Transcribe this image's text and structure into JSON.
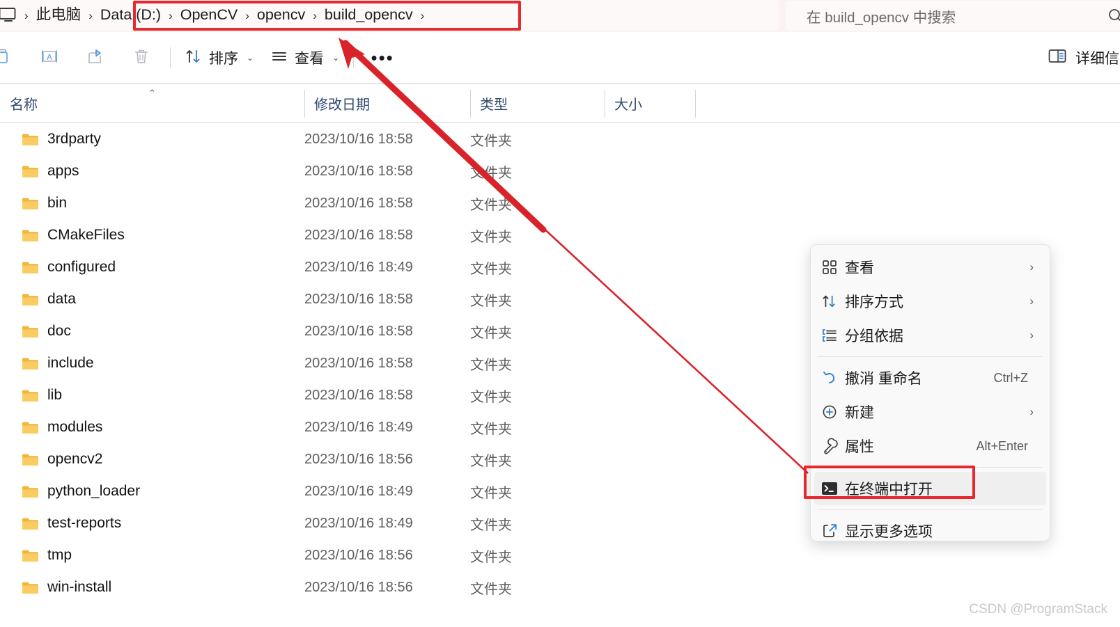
{
  "address_bar": {
    "pc_icon": "this-pc-icon",
    "breadcrumbs": [
      {
        "label": "此电脑",
        "highlighted": false
      },
      {
        "label": "Data (D:)",
        "highlighted": true
      },
      {
        "label": "OpenCV",
        "highlighted": true
      },
      {
        "label": "opencv",
        "highlighted": true
      },
      {
        "label": "build_opencv",
        "highlighted": true
      }
    ],
    "separator": "›",
    "highlight_color": "#e8282d"
  },
  "search": {
    "placeholder": "在 build_opencv 中搜索",
    "icon": "search-icon"
  },
  "toolbar": {
    "icon_buttons": [
      {
        "name": "paste-button",
        "icon": "clipboard-paste-icon"
      },
      {
        "name": "rename-button",
        "icon": "rename-icon"
      },
      {
        "name": "share-button",
        "icon": "share-icon"
      },
      {
        "name": "delete-button",
        "icon": "trash-icon"
      }
    ],
    "sort_label": "排序",
    "view_label": "查看",
    "more_label": "•••",
    "details_label": "详细信息",
    "chevron": "⌄"
  },
  "columns": [
    {
      "label": "名称",
      "sorted": true,
      "sort_caret": "⌃"
    },
    {
      "label": "修改日期",
      "sorted": false
    },
    {
      "label": "类型",
      "sorted": false
    },
    {
      "label": "大小",
      "sorted": false
    }
  ],
  "files": [
    {
      "name": "3rdparty",
      "date": "2023/10/16 18:58",
      "type": "文件夹",
      "size": ""
    },
    {
      "name": "apps",
      "date": "2023/10/16 18:58",
      "type": "文件夹",
      "size": ""
    },
    {
      "name": "bin",
      "date": "2023/10/16 18:58",
      "type": "文件夹",
      "size": ""
    },
    {
      "name": "CMakeFiles",
      "date": "2023/10/16 18:58",
      "type": "文件夹",
      "size": ""
    },
    {
      "name": "configured",
      "date": "2023/10/16 18:49",
      "type": "文件夹",
      "size": ""
    },
    {
      "name": "data",
      "date": "2023/10/16 18:58",
      "type": "文件夹",
      "size": ""
    },
    {
      "name": "doc",
      "date": "2023/10/16 18:58",
      "type": "文件夹",
      "size": ""
    },
    {
      "name": "include",
      "date": "2023/10/16 18:58",
      "type": "文件夹",
      "size": ""
    },
    {
      "name": "lib",
      "date": "2023/10/16 18:58",
      "type": "文件夹",
      "size": ""
    },
    {
      "name": "modules",
      "date": "2023/10/16 18:49",
      "type": "文件夹",
      "size": ""
    },
    {
      "name": "opencv2",
      "date": "2023/10/16 18:56",
      "type": "文件夹",
      "size": ""
    },
    {
      "name": "python_loader",
      "date": "2023/10/16 18:49",
      "type": "文件夹",
      "size": ""
    },
    {
      "name": "test-reports",
      "date": "2023/10/16 18:49",
      "type": "文件夹",
      "size": ""
    },
    {
      "name": "tmp",
      "date": "2023/10/16 18:56",
      "type": "文件夹",
      "size": ""
    },
    {
      "name": "win-install",
      "date": "2023/10/16 18:56",
      "type": "文件夹",
      "size": ""
    }
  ],
  "context_menu": {
    "items": [
      {
        "label": "查看",
        "icon": "grid-view-icon",
        "accel": "",
        "submenu": true,
        "highlighted": false
      },
      {
        "label": "排序方式",
        "icon": "sort-arrows-icon",
        "accel": "",
        "submenu": true,
        "highlighted": false
      },
      {
        "label": "分组依据",
        "icon": "group-by-icon",
        "accel": "",
        "submenu": true,
        "highlighted": false
      },
      {
        "label": "撤消 重命名",
        "icon": "undo-icon",
        "accel": "Ctrl+Z",
        "submenu": false,
        "highlighted": false
      },
      {
        "label": "新建",
        "icon": "plus-circle-icon",
        "accel": "",
        "submenu": true,
        "highlighted": false
      },
      {
        "label": "属性",
        "icon": "wrench-icon",
        "accel": "Alt+Enter",
        "submenu": false,
        "highlighted": false
      },
      {
        "label": "在终端中打开",
        "icon": "terminal-icon",
        "accel": "",
        "submenu": false,
        "highlighted": true
      },
      {
        "label": "显示更多选项",
        "icon": "show-more-icon",
        "accel": "",
        "submenu": false,
        "highlighted": false
      }
    ]
  },
  "annotation": {
    "arrow_color": "#d9232a",
    "highlight_color": "#e8282d"
  },
  "watermark": "CSDN @ProgramStack"
}
